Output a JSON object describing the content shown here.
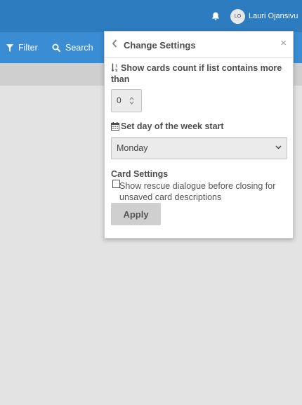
{
  "header": {
    "user_initials": "LO",
    "user_name": "Lauri Ojansivu"
  },
  "filterbar": {
    "filter_label": "Filter",
    "search_label": "Search"
  },
  "popup": {
    "title": "Change Settings",
    "close_glyph": "×",
    "cards_count_label": "Show cards count if list contains more than",
    "cards_count_value": "0",
    "week_start_label": "Set day of the week start",
    "week_start_value": "Monday",
    "card_settings_heading": "Card Settings",
    "rescue_dialog_label": "Show rescue dialogue before closing for unsaved card descriptions",
    "apply_label": "Apply"
  },
  "icons": {
    "bell": "bell-icon",
    "filter": "filter-icon",
    "search": "search-icon",
    "back": "chevron-left-icon",
    "sort_numeric": "sort-numeric-icon",
    "calendar": "calendar-icon"
  },
  "colors": {
    "topbar": "#2c7cbf",
    "filterbar": "#3a8dd2",
    "apply_button": "#cfcfcf"
  }
}
